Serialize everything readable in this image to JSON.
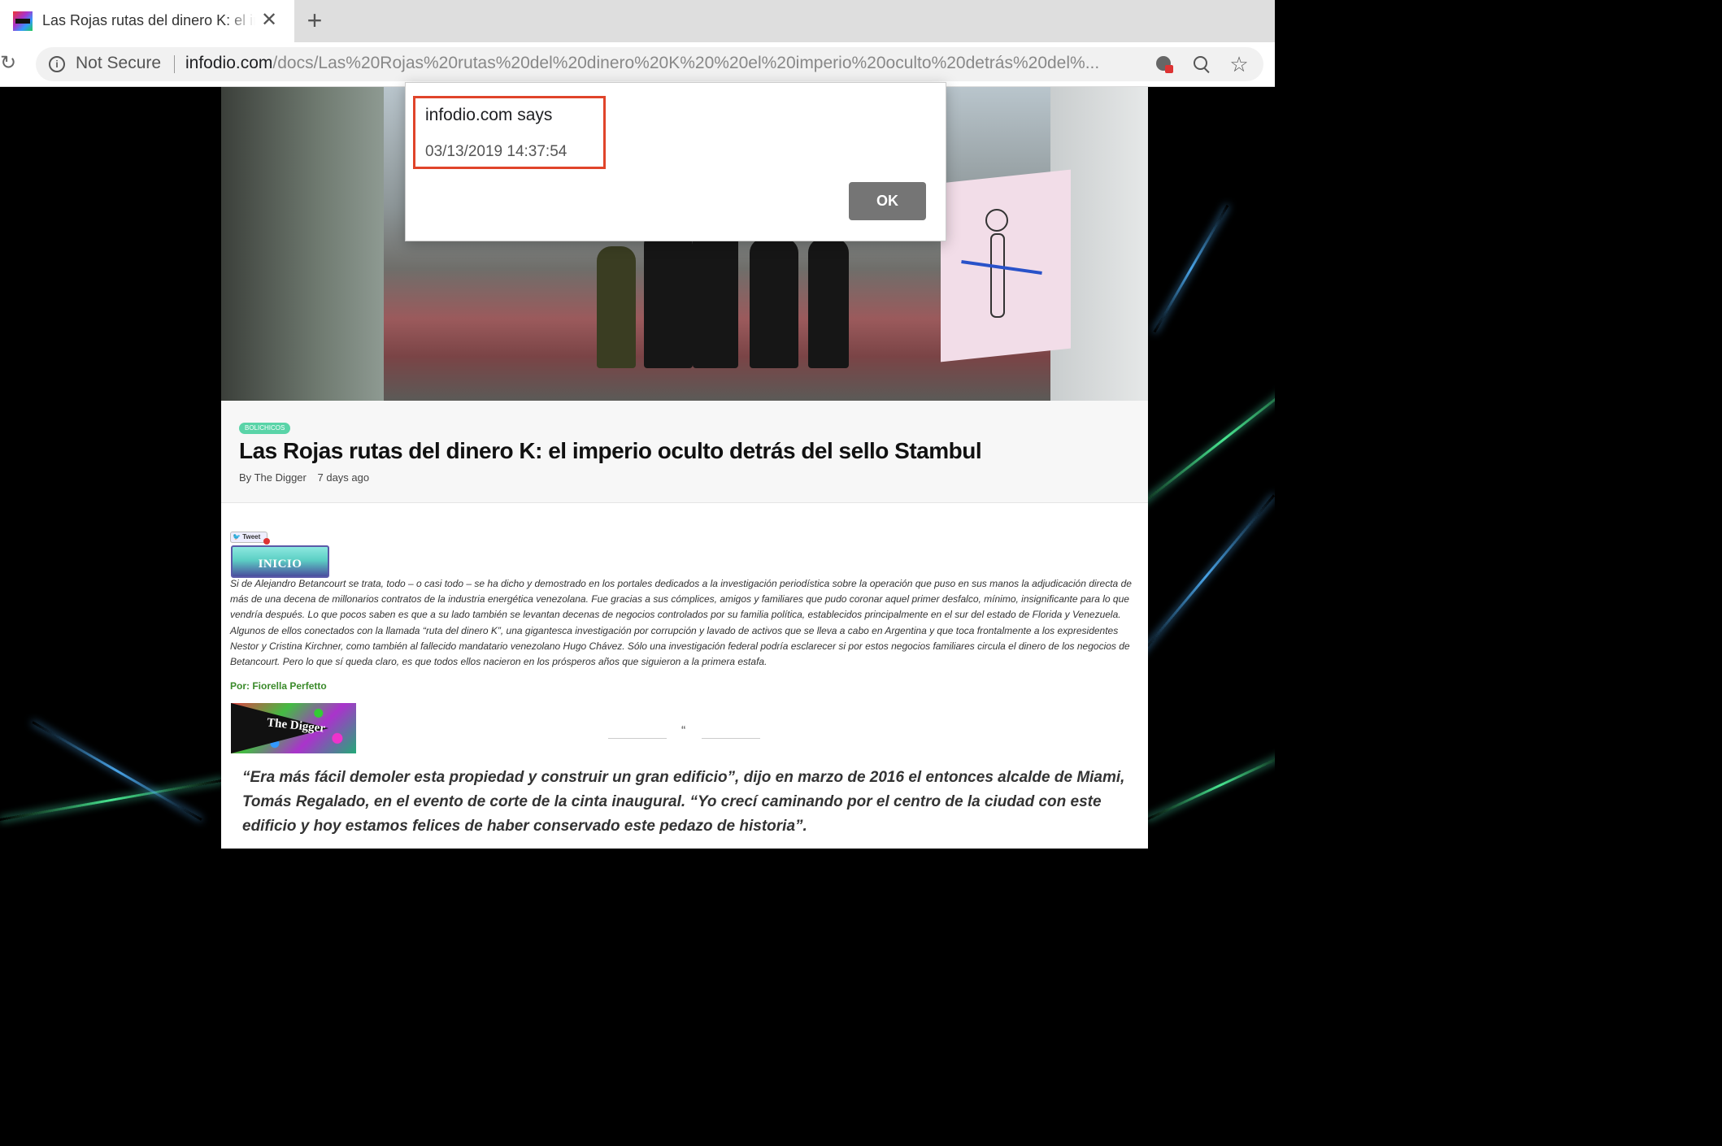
{
  "browser": {
    "tab_title": "Las Rojas rutas del dinero K: el imperio oculto detrás del sello Stambul",
    "tab_close": "✕",
    "new_tab": "+",
    "security_label": "Not Secure",
    "url_host": "infodio.com",
    "url_path": "/docs/Las%20Rojas%20rutas%20del%20dinero%20K%20%20el%20imperio%20oculto%20detrás%20del%...",
    "icons": [
      "reload-icon",
      "info-icon",
      "cookie-blocked-icon",
      "zoom-icon",
      "star-icon"
    ]
  },
  "article": {
    "category": "BOLICHICOS",
    "title": "Las Rojas rutas del dinero K: el imperio oculto detrás del sello Stambul",
    "byline_prefix": "By",
    "author": "The Digger",
    "time_ago": "7 days ago",
    "tweet_label": "Tweet",
    "inicio_label": "INICIO",
    "intro": "Si de Alejandro Betancourt se trata, todo – o casi todo – se ha dicho y demostrado en los portales dedicados a la investigación periodística sobre la operación que puso en sus manos la adjudicación directa de más de una decena de millonarios contratos de la industria energética venezolana. Fue gracias a sus cómplices, amigos y familiares que pudo coronar aquel primer desfalco, mínimo, insignificante para lo que vendría después. Lo que pocos saben es que a su lado también se levantan decenas de negocios controlados por su familia política, establecidos principalmente en el sur del estado de Florida y Venezuela. Algunos de ellos conectados con la llamada “ruta del dinero K”, una gigantesca investigación por corrupción y lavado de activos que se lleva a cabo en Argentina y que toca frontalmente a los expresidentes Nestor y Cristina Kirchner, como también al fallecido mandatario venezolano Hugo Chávez. Sólo una investigación federal podría esclarecer si por estos negocios familiares circula el dinero de los negocios de Betancourt. Pero lo que sí queda claro, es que todos ellos nacieron en los prósperos años que siguieron a la primera estafa.",
    "author_credit": "Por: Fiorella Perfetto",
    "logo_text": "The Digger",
    "quote_mark": "“",
    "pull_quote": "“Era más fácil demoler esta propiedad y construir un gran edificio”, dijo en marzo de 2016 el entonces alcalde de Miami, Tomás Regalado, en el evento de corte de la cinta inaugural. “Yo crecí caminando por el centro de la ciudad con este edificio y hoy estamos felices de haber conservado este pedazo de historia”."
  },
  "dialog": {
    "title": "infodio.com says",
    "message": "03/13/2019 14:37:54",
    "ok_label": "OK",
    "highlight_color": "#e0442a"
  },
  "colors": {
    "badge": "#5ad4a8",
    "author_credit": "#3a8a2a",
    "ok_button": "#757575"
  }
}
